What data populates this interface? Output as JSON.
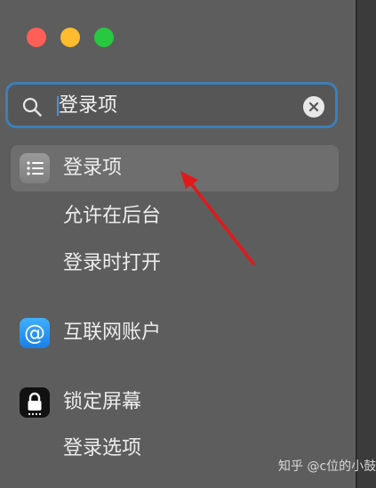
{
  "search": {
    "value": "登录项"
  },
  "sidebar": {
    "items": [
      {
        "label": "登录项",
        "icon": "list-icon",
        "selected": true
      },
      {
        "label": "允许在后台"
      },
      {
        "label": "登录时打开"
      },
      {
        "label": "互联网账户",
        "icon": "at-icon"
      },
      {
        "label": "锁定屏幕",
        "icon": "lock-icon"
      },
      {
        "label": "登录选项"
      }
    ]
  },
  "watermark": "知乎 @c位的小鼓",
  "colors": {
    "search_border": "#3d7fb8",
    "annotation_arrow": "#e0191b",
    "close": "#ff5f57",
    "minimize": "#febc2e",
    "maximize": "#28c840"
  }
}
